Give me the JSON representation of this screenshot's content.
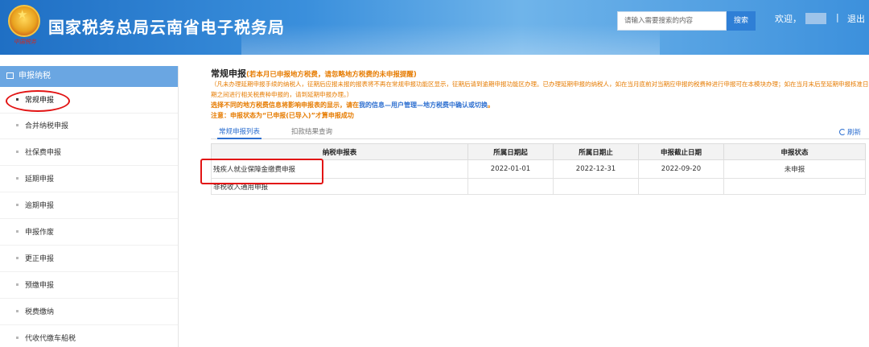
{
  "header": {
    "emblem_text": "中国税务",
    "site_title": "国家税务总局云南省电子税务局",
    "search_placeholder": "请输入需要搜索的内容",
    "search_button": "搜索",
    "welcome": "欢迎，",
    "separator": "|",
    "logout": "退出"
  },
  "sidebar": {
    "head_label": "申报纳税",
    "items": [
      {
        "label": "常规申报"
      },
      {
        "label": "合并纳税申报"
      },
      {
        "label": "社保费申报"
      },
      {
        "label": "延期申报"
      },
      {
        "label": "逾期申报"
      },
      {
        "label": "申报作废"
      },
      {
        "label": "更正申报"
      },
      {
        "label": "预缴申报"
      },
      {
        "label": "税费缴纳"
      },
      {
        "label": "代收代缴车船税"
      }
    ]
  },
  "main": {
    "title": "常规申报",
    "title_hint": "(若本月已申报地方税费，请忽略地方税费的未申报提醒)",
    "notice": "（凡未办理延期申报手续的纳税人，征期后应报未报的报表将不再在常规申报功能区显示，征期后请到逾期申报功能区办理。已办理延期申报的纳税人，如在当月底前对当期应申报的税费种进行申报可在本模块办理；如在当月末后至延期申报核准日期之间进行相关税费种申报的，请到延期申报办理。）",
    "notice2_pre": "选择不同的地方税费信息将影响申报表的显示，请在",
    "notice2_link": "我的信息—用户管理—地方税费中确认或切换",
    "notice2_post": "。",
    "notice3": "注意：申报状态为“已申报(已导入)”才算申报成功",
    "tabs": [
      "常规申报列表",
      "扣款结果查询"
    ],
    "refresh": "刷新",
    "table": {
      "headers": [
        "纳税申报表",
        "所属日期起",
        "所属日期止",
        "申报截止日期",
        "申报状态"
      ],
      "rows": [
        [
          "残疾人就业保障金缴费申报",
          "2022-01-01",
          "2022-12-31",
          "2022-09-20",
          "未申报"
        ],
        [
          "非税收入通用申报",
          "",
          "",
          "",
          ""
        ]
      ]
    }
  },
  "colors": {
    "header_blue": "#2f7fd6",
    "sidebar_head": "#6aa6e2",
    "notice_orange": "#e67b00",
    "link_blue": "#2d6fd0",
    "annotation_red": "#e21414"
  }
}
